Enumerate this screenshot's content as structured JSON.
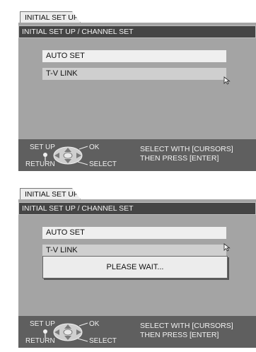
{
  "screens": [
    {
      "tab": "INITIAL SET UP",
      "breadcrumb": "INITIAL SET UP / CHANNEL SET",
      "menu": [
        "AUTO SET",
        "T-V LINK"
      ],
      "controls": {
        "setup": "SET UP",
        "ok": "OK",
        "return": "RETURN",
        "select": "SELECT"
      },
      "help": {
        "line1": "SELECT WITH [CURSORS]",
        "line2": "THEN PRESS [ENTER]"
      }
    },
    {
      "tab": "INITIAL SET UP",
      "breadcrumb": "INITIAL SET UP / CHANNEL SET",
      "menu": [
        "AUTO SET",
        "T-V LINK"
      ],
      "dialog": "PLEASE WAIT...",
      "controls": {
        "setup": "SET UP",
        "ok": "OK",
        "return": "RETURN",
        "select": "SELECT"
      },
      "help": {
        "line1": "SELECT WITH [CURSORS]",
        "line2": "THEN PRESS [ENTER]"
      }
    }
  ],
  "colors": {
    "panel": "#a4a4a4",
    "breadcrumb_bg": "#454545",
    "footer_bg": "#5f5f5f",
    "highlight": "#cfcfcf"
  },
  "icons": {
    "cursor": "pointer-arrow-icon",
    "remote": "remote-cursor-pad-icon"
  }
}
